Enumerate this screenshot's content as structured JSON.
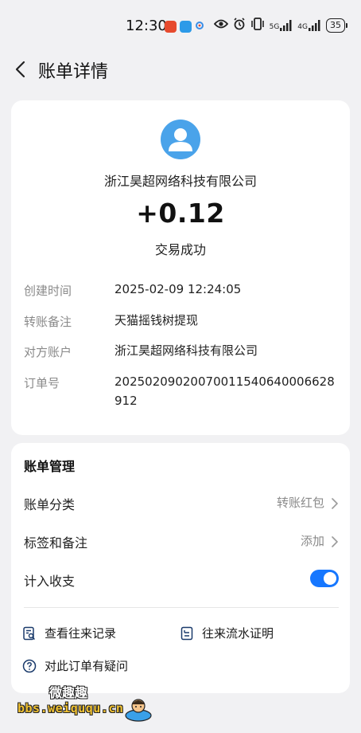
{
  "status_bar": {
    "time": "12:30",
    "signal_5g": "5G",
    "signal_4g": "4G",
    "battery": "35",
    "icons": [
      "taobao-app-icon",
      "message-app-icon",
      "browser-app-icon",
      "eye-icon",
      "alarm-icon",
      "vibrate-icon",
      "signal-icon",
      "battery-icon"
    ]
  },
  "nav": {
    "title": "账单详情",
    "back_icon": "chevron-left-icon"
  },
  "bill": {
    "payee": "浙江昊超网络科技有限公司",
    "amount": "+0.12",
    "status": "交易成功",
    "details": [
      {
        "label": "创建时间",
        "value": "2025-02-09 12:24:05"
      },
      {
        "label": "转账备注",
        "value": "天猫摇钱树提现"
      },
      {
        "label": "对方账户",
        "value": "浙江昊超网络科技有限公司"
      },
      {
        "label": "订单号",
        "value": "20250209020070011540640006628912"
      }
    ]
  },
  "manage": {
    "title": "账单管理",
    "category_label": "账单分类",
    "category_value": "转账红包",
    "tags_label": "标签和备注",
    "tags_value": "添加",
    "include_label": "计入收支",
    "include_on": true,
    "links": {
      "history": "查看往来记录",
      "proof": "往来流水证明",
      "question": "对此订单有疑问"
    }
  },
  "watermark": {
    "top": "微趣趣",
    "bottom": "bbs.weiququ.cn"
  },
  "colors": {
    "accent": "#1677ff",
    "avatar": "#4aa3ea",
    "background": "#f1f1f3",
    "watermark_text": "#f1c232"
  }
}
